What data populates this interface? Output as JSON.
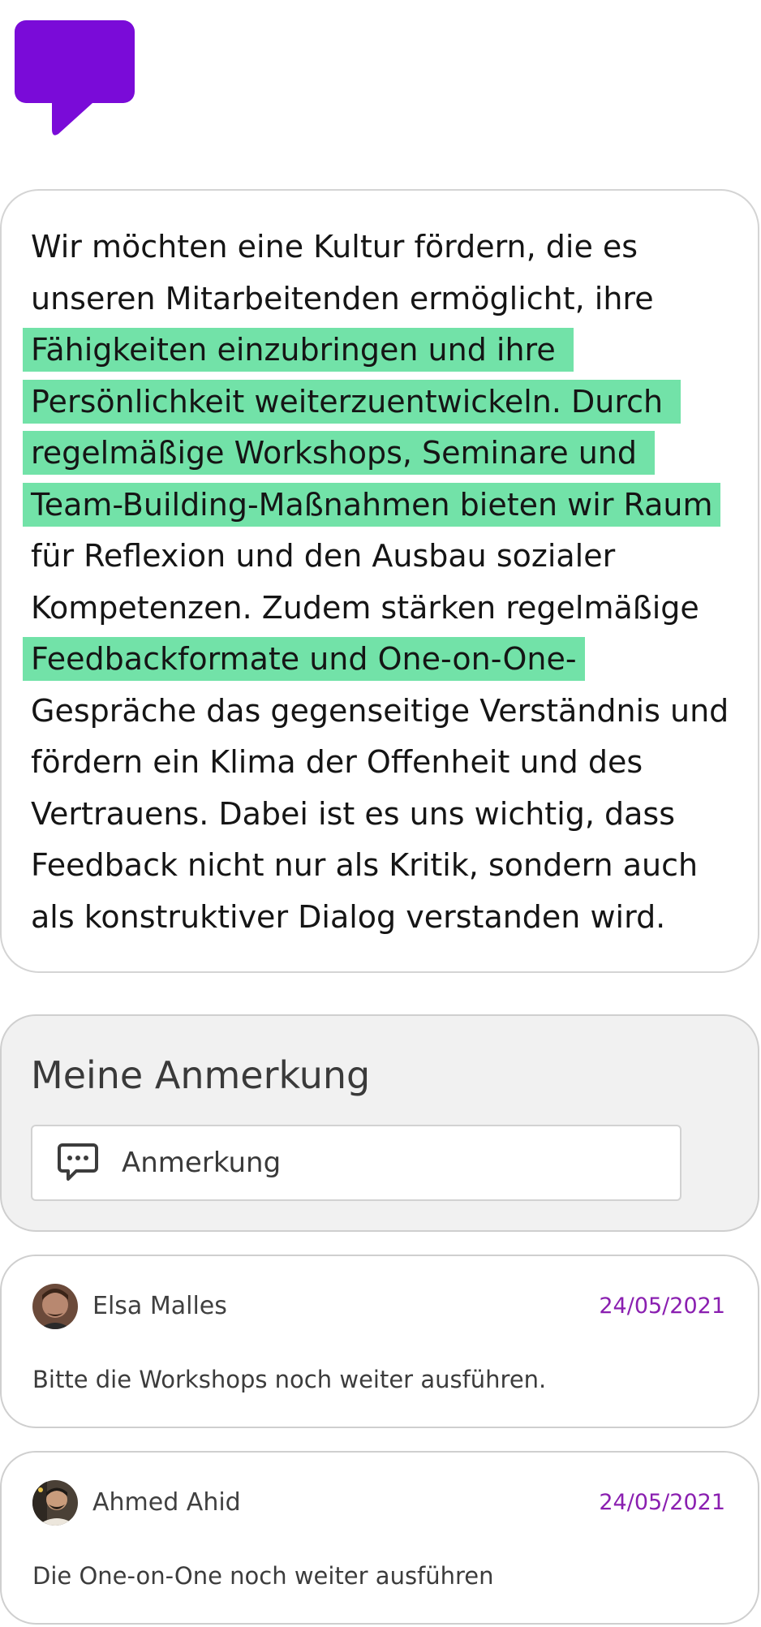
{
  "logo": {
    "icon": "speech-bubble-icon",
    "color": "#7a0bd8"
  },
  "article": {
    "highlight_color": "#72e2a8",
    "lines": [
      {
        "segments": [
          {
            "text": "Wir möchten eine Kultur fördern, die es",
            "hl": false
          }
        ]
      },
      {
        "segments": [
          {
            "text": "unseren Mitarbeitenden ermöglicht, ihre",
            "hl": false
          }
        ]
      },
      {
        "segments": [
          {
            "text": "Fähigkeiten einzubringen und ihre ",
            "hl": true
          }
        ]
      },
      {
        "segments": [
          {
            "text": "Persönlichkeit weiterzuentwickeln. Durch ",
            "hl": true
          }
        ]
      },
      {
        "segments": [
          {
            "text": "regelmäßige Workshops, Seminare und ",
            "hl": true
          }
        ]
      },
      {
        "segments": [
          {
            "text": "Team-Building-Maßnahmen bieten wir Raum",
            "hl": true
          }
        ]
      },
      {
        "segments": [
          {
            "text": "für Reflexion und den Ausbau sozialer",
            "hl": false
          }
        ]
      },
      {
        "segments": [
          {
            "text": "Kompetenzen. Zudem stärken regelmäßige",
            "hl": false
          }
        ]
      },
      {
        "segments": [
          {
            "text": "Feedbackformate und One-on-One-",
            "hl": true
          }
        ]
      },
      {
        "segments": [
          {
            "text": "Gespräche das gegenseitige Verständnis und",
            "hl": false
          }
        ]
      },
      {
        "segments": [
          {
            "text": "fördern ein Klima der Offenheit und des",
            "hl": false
          }
        ]
      },
      {
        "segments": [
          {
            "text": "Vertrauens. Dabei ist es uns wichtig, dass",
            "hl": false
          }
        ]
      },
      {
        "segments": [
          {
            "text": "Feedback nicht nur als Kritik, sondern auch",
            "hl": false
          }
        ]
      },
      {
        "segments": [
          {
            "text": "als konstruktiver Dialog verstanden wird.",
            "hl": false
          }
        ]
      }
    ]
  },
  "note": {
    "title": "Meine Anmerkung",
    "input_placeholder": "Anmerkung",
    "input_value": "",
    "icon": "chat-bubble-icon"
  },
  "comments": [
    {
      "name": "Elsa Malles",
      "date": "24/05/2021",
      "text": "Bitte die Workshops noch weiter ausführen."
    },
    {
      "name": "Ahmed Ahid",
      "date": "24/05/2021",
      "text": "Die One-on-One  noch weiter ausführen"
    }
  ]
}
